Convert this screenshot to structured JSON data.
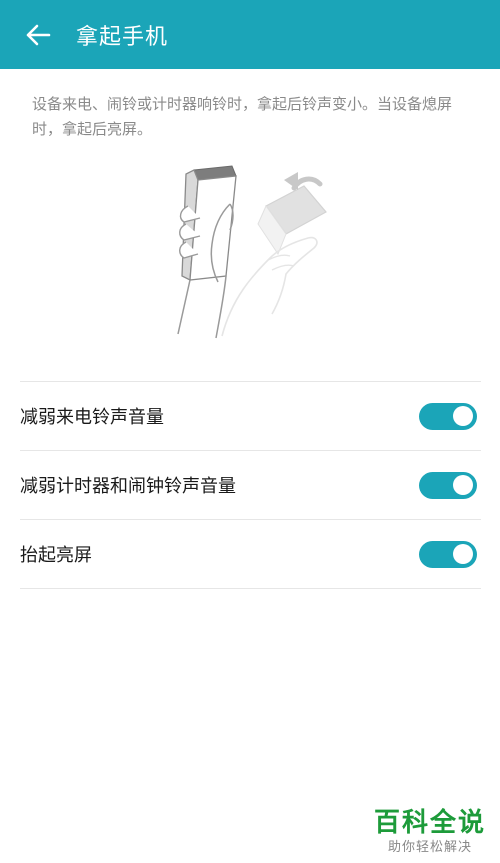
{
  "header": {
    "back_icon": "arrow-left-icon",
    "title": "拿起手机"
  },
  "description": "设备来电、闹铃或计时器响铃时，拿起后铃声变小。当设备熄屏时，拿起后亮屏。",
  "illustration": {
    "icon": "hand-lifting-phone-illustration"
  },
  "settings": [
    {
      "label": "减弱来电铃声音量",
      "enabled": true
    },
    {
      "label": "减弱计时器和闹钟铃声音量",
      "enabled": true
    },
    {
      "label": "抬起亮屏",
      "enabled": true
    }
  ],
  "colors": {
    "accent": "#1ba5b8",
    "watermark": "#1d9b3a"
  },
  "watermark": {
    "brand": "百科全说",
    "subtitle": "助你轻松解决"
  }
}
